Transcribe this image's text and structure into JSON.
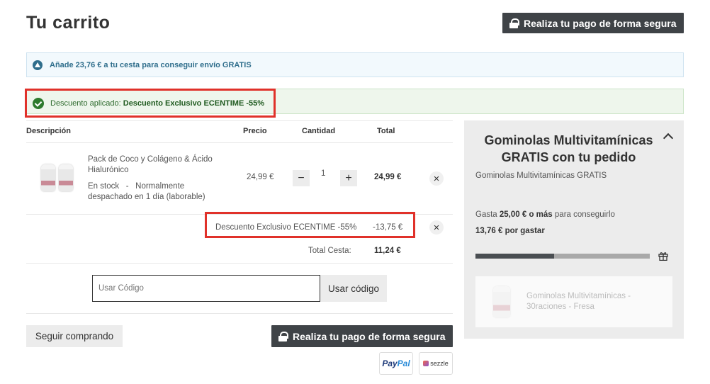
{
  "header": {
    "title": "Tu carrito",
    "secure_pay_label": "Realiza tu pago de forma segura"
  },
  "shipping_banner": {
    "text": "Añade 23,76 € a tu cesta para conseguir envío GRATIS"
  },
  "discount_banner": {
    "prefix": "Descuento aplicado:",
    "name": "Descuento Exclusivo ECENTIME -55%"
  },
  "table": {
    "headers": {
      "description": "Descripción",
      "price": "Precio",
      "quantity": "Cantidad",
      "total": "Total"
    }
  },
  "cart_item": {
    "name": "Pack de Coco y Colágeno & Ácido Hialurónico",
    "stock": "En stock",
    "separator": "-",
    "shipping": "Normalmente despachado en 1 día (laborable)",
    "price": "24,99 €",
    "quantity": "1",
    "line_total": "24,99 €",
    "minus": "−",
    "plus": "+",
    "remove": "×"
  },
  "discount_line": {
    "label": "Descuento Exclusivo ECENTIME -55%",
    "amount": "-13,75 €",
    "remove": "×"
  },
  "cart_total": {
    "label": "Total Cesta:",
    "value": "11,24 €"
  },
  "coupon": {
    "placeholder": "Usar Código",
    "button": "Usar código"
  },
  "actions": {
    "continue_shopping": "Seguir comprando",
    "secure_pay_label": "Realiza tu pago de forma segura"
  },
  "payment_methods": {
    "paypal_a": "Pay",
    "paypal_b": "Pal",
    "sezzle": "sezzle"
  },
  "sidebar": {
    "title": "Gominolas Multivitamínicas GRATIS con tu pedido",
    "subtitle": "Gominolas Multivitamínicas GRATIS",
    "gasta_prefix": "Gasta",
    "gasta_amount": "25,00 € o más",
    "gasta_suffix": "para conseguirlo",
    "remaining": "13,76 € por gastar",
    "progress_fraction": 0.45,
    "gift_product_name": "Gominolas Multivitamínicas - 30raciones - Fresa"
  },
  "colors": {
    "accent_dark": "#3f4347",
    "highlight_red": "#e0312a",
    "success_green": "#2d7a2d",
    "info_blue": "#2f6e8c"
  }
}
